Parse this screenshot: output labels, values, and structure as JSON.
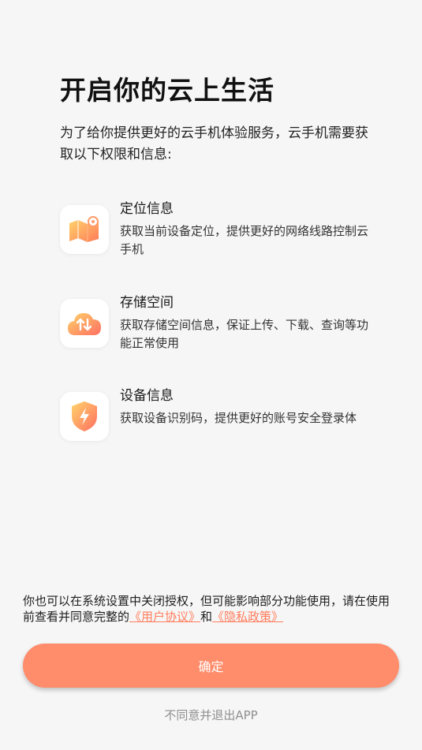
{
  "page": {
    "title": "开启你的云上生活",
    "intro": "为了给你提供更好的云手机体验服务，云手机需要获取以下权限和信息:"
  },
  "permissions": [
    {
      "title": "定位信息",
      "description": "获取当前设备定位，提供更好的网络线路控制云手机",
      "icon": "map-location-icon"
    },
    {
      "title": "存储空间",
      "description": "获取存储空间信息，保证上传、下载、查询等功能正常使用",
      "icon": "cloud-storage-icon"
    },
    {
      "title": "设备信息",
      "description": "获取设备识别码，提供更好的账号安全登录体",
      "icon": "shield-lightning-icon"
    }
  ],
  "notice": {
    "text_before": "你也可以在系统设置中关闭授权，但可能影响部分功能使用，请在使用前查看并同意完整的",
    "user_agreement_link": "《用户协议》",
    "conjunction": "和",
    "privacy_policy_link": "《隐私政策》"
  },
  "actions": {
    "confirm_label": "确定",
    "decline_label": "不同意并退出APP"
  },
  "colors": {
    "accent": "#ff8c6b",
    "link": "#ff7d5c",
    "background": "#f6f6f6"
  }
}
